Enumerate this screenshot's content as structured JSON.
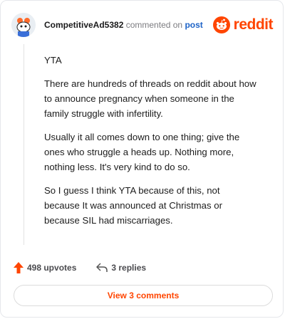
{
  "comment": {
    "username": "CompetitiveAd5382",
    "commented_on_text": "commented on",
    "post_link": "post",
    "brand": "reddit",
    "paragraphs": [
      "YTA",
      "There are hundreds of threads on reddit about how to announce pregnancy when someone in the family struggle with infertility.",
      "Usually it all comes down to one thing; give the ones who struggle a heads up. Nothing more, nothing less. It's very kind to do so.",
      "So I guess I think YTA because of this, not because It was announced at Christmas or because SIL had miscarriages."
    ],
    "upvotes": "498 upvotes",
    "replies": "3 replies",
    "view_button": "View 3 comments"
  },
  "colors": {
    "brand": "#ff4500",
    "link": "#1d63c7"
  },
  "icons": [
    "avatar",
    "reddit-logo-icon",
    "upvote-arrow-icon",
    "reply-arrow-icon"
  ]
}
